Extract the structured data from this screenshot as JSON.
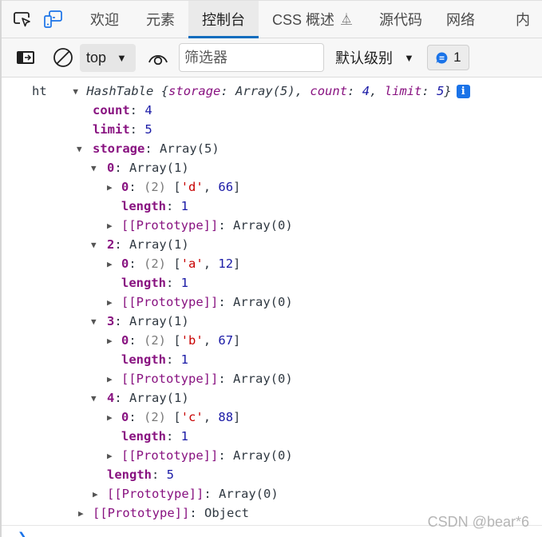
{
  "tabs": {
    "inspect_icon": "inspect-element-icon",
    "device_icon": "device-emulation-icon",
    "items": [
      {
        "label": "欢迎",
        "active": false
      },
      {
        "label": "元素",
        "active": false
      },
      {
        "label": "控制台",
        "active": true
      },
      {
        "label": "CSS 概述",
        "active": false,
        "experimental_icon": "flask-icon"
      },
      {
        "label": "源代码",
        "active": false
      },
      {
        "label": "网络",
        "active": false
      },
      {
        "label": "内",
        "active": false
      }
    ]
  },
  "toolbar": {
    "context": "top",
    "filter_placeholder": "筛选器",
    "filter_value": "",
    "levels": "默认级别",
    "issues_count": "1",
    "accent": "#1a73e8"
  },
  "console": {
    "var_name": "ht",
    "summary": {
      "class": "HashTable",
      "open": "{",
      "k1": "storage",
      "v1": "Array(5)",
      "k2": "count",
      "v2": "4",
      "k3": "limit",
      "v3": "5",
      "close": "}"
    },
    "count": {
      "key": "count",
      "value": "4"
    },
    "limit": {
      "key": "limit",
      "value": "5"
    },
    "storage": {
      "key": "storage",
      "value": "Array(5)"
    },
    "buckets": [
      {
        "index": "0",
        "type": "Array(1)",
        "entry_index": "0",
        "entry_len": "(2)",
        "entry_key": "'d'",
        "entry_val": "66",
        "length": "1",
        "proto": "[[Prototype]]",
        "proto_val": "Array(0)"
      },
      {
        "index": "2",
        "type": "Array(1)",
        "entry_index": "0",
        "entry_len": "(2)",
        "entry_key": "'a'",
        "entry_val": "12",
        "length": "1",
        "proto": "[[Prototype]]",
        "proto_val": "Array(0)"
      },
      {
        "index": "3",
        "type": "Array(1)",
        "entry_index": "0",
        "entry_len": "(2)",
        "entry_key": "'b'",
        "entry_val": "67",
        "length": "1",
        "proto": "[[Prototype]]",
        "proto_val": "Array(0)"
      },
      {
        "index": "4",
        "type": "Array(1)",
        "entry_index": "0",
        "entry_len": "(2)",
        "entry_key": "'c'",
        "entry_val": "88",
        "length": "1",
        "proto": "[[Prototype]]",
        "proto_val": "Array(0)"
      }
    ],
    "storage_length": {
      "key": "length",
      "value": "5"
    },
    "storage_proto": {
      "key": "[[Prototype]]",
      "value": "Array(0)"
    },
    "object_proto": {
      "key": "[[Prototype]]",
      "value": "Object"
    }
  },
  "watermark": "CSDN @bear*6"
}
